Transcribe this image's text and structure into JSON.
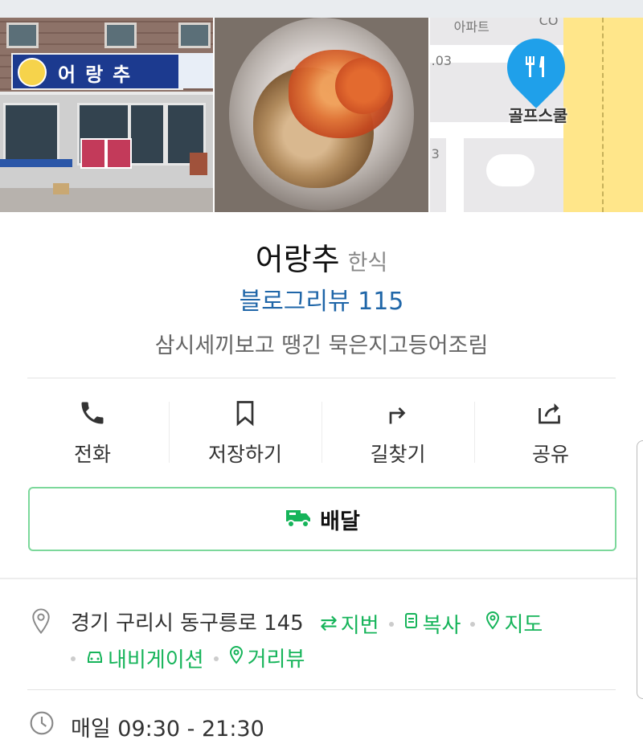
{
  "place": {
    "name": "어랑추",
    "category": "한식",
    "blog_review": "블로그리뷰 115",
    "description": "삼시세끼보고 땡긴 묵은지고등어조림"
  },
  "photos": {
    "store_sign_text": "어랑추",
    "map_labels": [
      "아파트",
      "CO",
      ".03",
      "골프스쿨",
      "3"
    ]
  },
  "actions": [
    {
      "label": "전화",
      "icon": "phone-icon"
    },
    {
      "label": "저장하기",
      "icon": "bookmark-icon"
    },
    {
      "label": "길찾기",
      "icon": "directions-icon"
    },
    {
      "label": "공유",
      "icon": "share-icon"
    }
  ],
  "delivery": {
    "label": "배달",
    "icon": "delivery-truck-icon"
  },
  "address": {
    "text": "경기 구리시 동구릉로 145",
    "links": [
      "지번",
      "복사",
      "지도",
      "내비게이션",
      "거리뷰"
    ]
  },
  "hours": {
    "text": "매일 09:30 - 21:30"
  },
  "colors": {
    "accent_green": "#16b45a",
    "blog_blue": "#1f66a8",
    "map_pin": "#1fa0ea",
    "delivery_border": "#7cd89b"
  }
}
